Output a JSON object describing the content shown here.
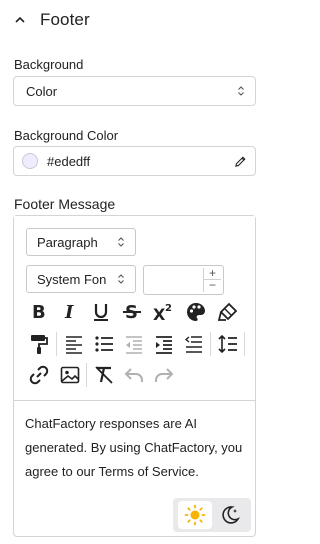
{
  "section": {
    "title": "Footer"
  },
  "background": {
    "label": "Background",
    "value": "Color"
  },
  "background_color": {
    "label": "Background Color",
    "value": "#ededff",
    "swatch": "#ededff"
  },
  "footer_message": {
    "label": "Footer Message",
    "block_format": "Paragraph",
    "font_family": "System Fon",
    "font_size": "",
    "text": "ChatFactory responses are AI generated. By using ChatFactory, you agree to our Terms of Service.",
    "toolbar_icons": [
      "bold-icon",
      "italic-icon",
      "underline-icon",
      "strikethrough-icon",
      "superscript-icon",
      "palette-icon",
      "highlighter-icon",
      "paint-roller-icon",
      "align-left-icon",
      "bulleted-list-icon",
      "outdent-icon",
      "indent-icon",
      "rtl-text-icon",
      "line-height-icon",
      "link-icon",
      "image-icon",
      "clear-format-icon",
      "undo-icon",
      "redo-icon"
    ],
    "theme": {
      "active": "light",
      "icons": [
        "sun-icon",
        "moon-icon"
      ],
      "sun_color": "#f5b400"
    }
  }
}
